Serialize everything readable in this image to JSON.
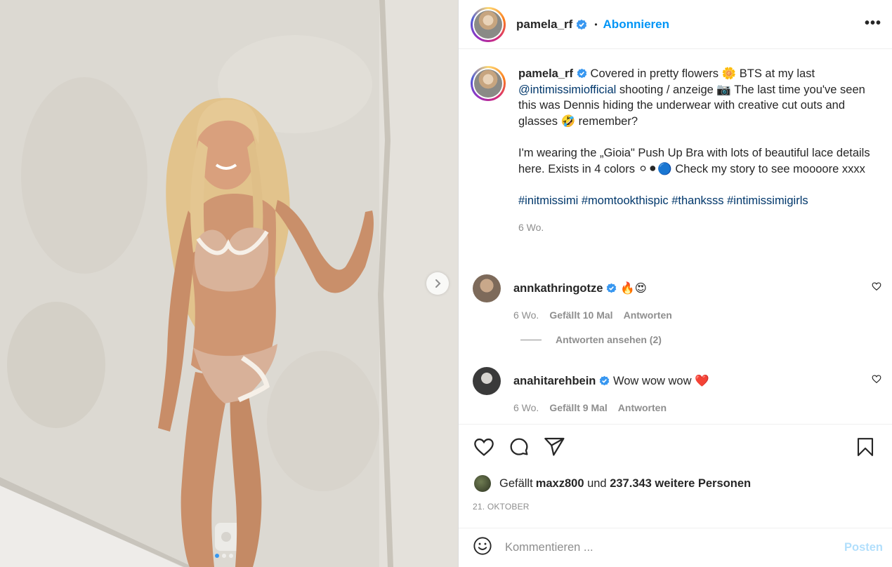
{
  "post": {
    "username": "pamela_rf",
    "follow_label": "Abonnieren",
    "separator": "•",
    "more_label": "•••"
  },
  "caption": {
    "username": "pamela_rf",
    "p1_a": " Covered in pretty flowers 🌼 BTS at my last ",
    "mention": "@intimissimiofficial",
    "p1_b": " shooting / anzeige 📷 The last time you've seen this was Dennis hiding the underwear with creative cut outs and glasses 🤣 remember?",
    "p2": "I'm wearing the „Gioia\" Push Up Bra with lots of beautiful lace details here. Exists in 4 colors ⚪⚫🔵 Check my story to see moooore xxxx",
    "hashtags": "#initmissimi #momtookthispic #thanksss #intimissimigirls",
    "time": "6 Wo."
  },
  "comments": [
    {
      "username": "annkathringotze",
      "text": "🔥😍",
      "time": "6 Wo.",
      "likes": "Gefällt 10 Mal",
      "reply": "Antworten"
    },
    {
      "username": "anahitarehbein",
      "text": "Wow wow wow ❤️",
      "time": "6 Wo.",
      "likes": "Gefällt 9 Mal",
      "reply": "Antworten"
    }
  ],
  "view_replies": "Antworten ansehen (2)",
  "likes": {
    "prefix": "Gefällt ",
    "user": "maxz800",
    "middle": " und ",
    "count": "237.343 weitere Personen"
  },
  "date": "21. OKTOBER",
  "comment_input": {
    "placeholder": "Kommentieren ...",
    "value": ""
  },
  "post_button": "Posten",
  "icons": [
    "verified-icon",
    "more-icon",
    "heart-icon",
    "comment-icon",
    "share-icon",
    "bookmark-icon",
    "emoji-icon",
    "chevron-right-icon"
  ],
  "colors": {
    "link": "#00376b",
    "follow": "#0095f6",
    "muted": "#8e8e8e",
    "post_disabled": "#b2dffc",
    "verified": "#3897f0"
  }
}
